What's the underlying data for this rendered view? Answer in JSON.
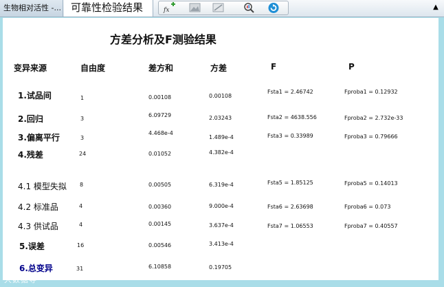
{
  "window": {
    "tab_inactive_label": "生物相对活性 -...",
    "tab_active_label": "可靠性检验结果"
  },
  "toolbar": {
    "icons": [
      "function-add-icon",
      "image-icon",
      "chart-icon",
      "zoom-settings-icon",
      "refresh-icon"
    ]
  },
  "report": {
    "title": "方差分析及F测验结果",
    "headers": {
      "source": "变异来源",
      "df": "自由度",
      "ss": "差方和",
      "ms": "方差",
      "f": "F",
      "p": "P"
    },
    "rows": [
      {
        "source": "1.试品间",
        "df": "1",
        "ss": "0.00108",
        "ms": "0.00108",
        "f": "Fsta1 = 2.46742",
        "p": "Fproba1 = 0.12932"
      },
      {
        "source": "2.回归",
        "df": "3",
        "ss": "6.09729",
        "ms": "2.03243",
        "f": "Fsta2 = 4638.556",
        "p": "Fproba2 = 2.732e-33"
      },
      {
        "source": "3.偏离平行",
        "df": "3",
        "ss": "4.468e-4",
        "ms": "1.489e-4",
        "f": "Fsta3 = 0.33989",
        "p": "Fproba3 = 0.79666"
      },
      {
        "source": "4.残差",
        "df": "24",
        "ss": "0.01052",
        "ms": "4.382e-4",
        "f": "",
        "p": ""
      },
      {
        "source": "4.1 模型失拟",
        "df": "8",
        "ss": "0.00505",
        "ms": "6.319e-4",
        "f": "Fsta5 = 1.85125",
        "p": "Fproba5 = 0.14013"
      },
      {
        "source": "4.2 标准品",
        "df": "4",
        "ss": "0.00360",
        "ms": "9.000e-4",
        "f": "Fsta6 = 2.63698",
        "p": "Fproba6 = 0.073"
      },
      {
        "source": "4.3 供试品",
        "df": "4",
        "ss": "0.00145",
        "ms": "3.637e-4",
        "f": "Fsta7 = 1.06553",
        "p": "Fproba7 = 0.40557"
      },
      {
        "source": "5.误差",
        "df": "16",
        "ss": "0.00546",
        "ms": "3.413e-4",
        "f": "",
        "p": ""
      },
      {
        "source": "6.总变异",
        "df": "31",
        "ss": "6.10858",
        "ms": "0.19705",
        "f": "",
        "p": ""
      }
    ]
  },
  "watermark": "大数据导"
}
